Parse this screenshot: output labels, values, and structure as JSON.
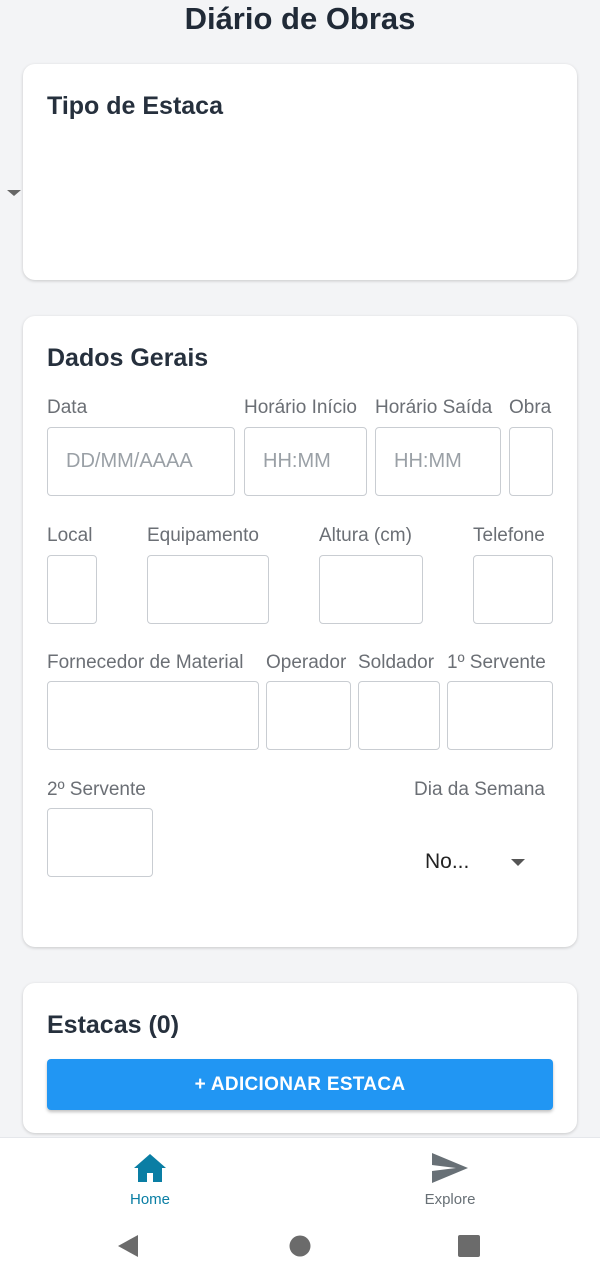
{
  "header": {
    "title": "Diário de Obras"
  },
  "tipo_card": {
    "title": "Tipo de Estaca"
  },
  "dados_card": {
    "title": "Dados Gerais",
    "labels": {
      "data": "Data",
      "horario_inicio": "Horário Início",
      "horario_saida": "Horário Saída",
      "obra": "Obra",
      "local": "Local",
      "equipamento": "Equipamento",
      "altura": "Altura (cm)",
      "telefone": "Telefone",
      "fornecedor": "Fornecedor de Material",
      "operador": "Operador",
      "soldador": "Soldador",
      "servente1": "1º Servente",
      "servente2": "2º Servente",
      "dia_semana": "Dia da Semana"
    },
    "placeholders": {
      "data": "DD/MM/AAAA",
      "horario_inicio": "HH:MM",
      "horario_saida": "HH:MM"
    },
    "dia_semana_value": "No..."
  },
  "estacas_card": {
    "title": "Estacas (0)",
    "add_button": "+ ADICIONAR ESTACA"
  },
  "bottom_nav": {
    "items": [
      {
        "label": "Home",
        "icon": "home-icon",
        "active": true
      },
      {
        "label": "Explore",
        "icon": "send-icon",
        "active": false
      }
    ]
  },
  "colors": {
    "accent": "#2196f3",
    "nav_active": "#0a7ea4",
    "nav_inactive": "#687076"
  }
}
